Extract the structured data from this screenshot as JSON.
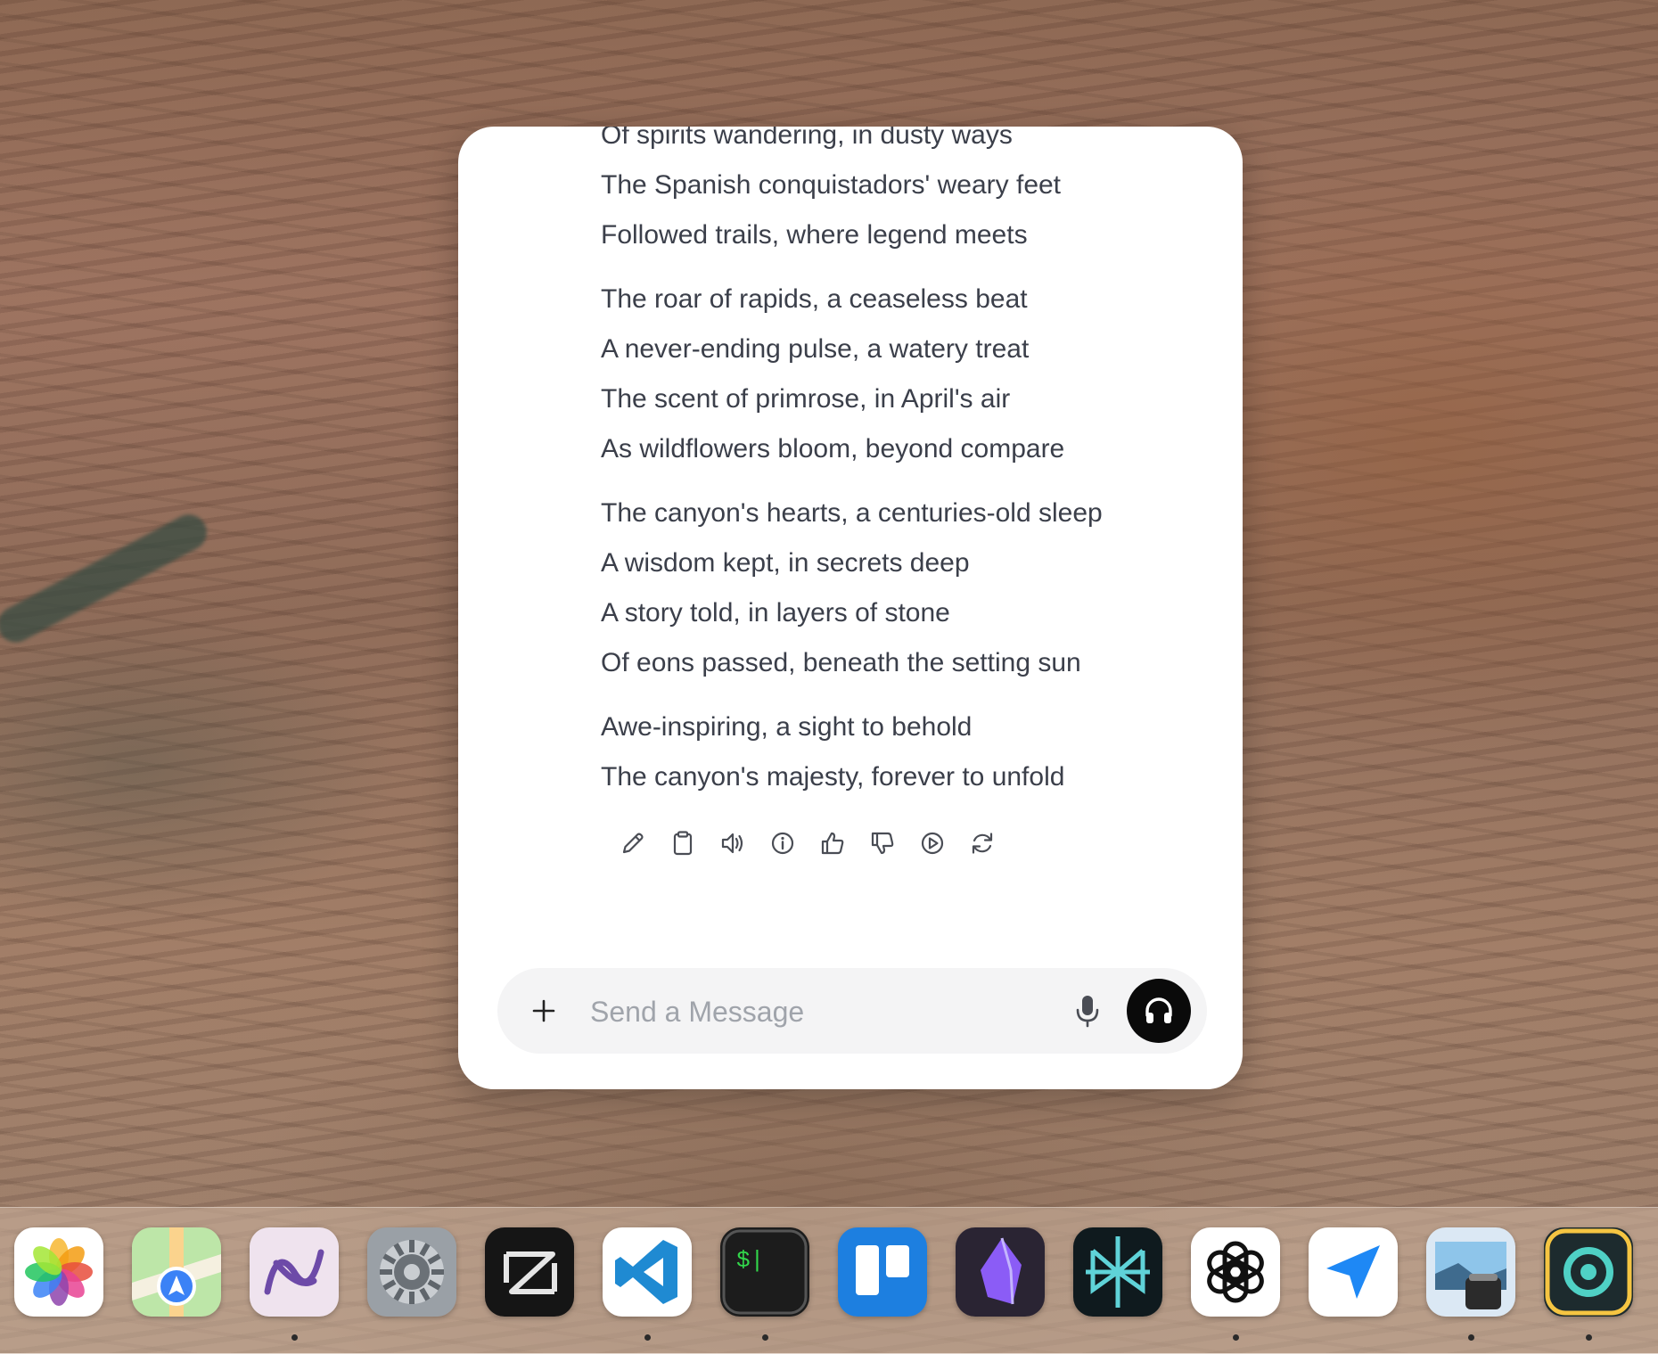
{
  "poem": {
    "stanzas": [
      {
        "lines": [
          "Of spirits wandering, in dusty ways",
          "The Spanish conquistadors' weary feet",
          "Followed trails, where legend meets"
        ]
      },
      {
        "lines": [
          "The roar of rapids, a ceaseless beat",
          "A never-ending pulse, a watery treat",
          "The scent of primrose, in April's air",
          "As wildflowers bloom, beyond compare"
        ]
      },
      {
        "lines": [
          "The canyon's hearts, a centuries-old sleep",
          "A wisdom kept, in secrets deep",
          "A story told, in layers of stone",
          "Of eons passed, beneath the setting sun"
        ]
      },
      {
        "lines": [
          "Awe-inspiring, a sight to behold",
          "The canyon's majesty, forever to unfold"
        ]
      }
    ]
  },
  "actions": [
    {
      "name": "edit-button",
      "icon": "pencil-icon"
    },
    {
      "name": "copy-button",
      "icon": "clipboard-icon"
    },
    {
      "name": "read-aloud-button",
      "icon": "speaker-icon"
    },
    {
      "name": "info-button",
      "icon": "info-icon"
    },
    {
      "name": "thumbs-up-button",
      "icon": "thumbs-up-icon"
    },
    {
      "name": "thumbs-down-button",
      "icon": "thumbs-down-icon"
    },
    {
      "name": "continue-button",
      "icon": "play-circle-icon"
    },
    {
      "name": "regenerate-button",
      "icon": "refresh-icon"
    }
  ],
  "composer": {
    "placeholder": "Send a Message",
    "value": ""
  },
  "dock": {
    "apps": [
      {
        "name": "photos",
        "icon": "photos-icon",
        "running": false
      },
      {
        "name": "maps",
        "icon": "maps-icon",
        "running": false
      },
      {
        "name": "arc-ai",
        "icon": "scribble-app-icon",
        "running": true
      },
      {
        "name": "system-settings",
        "icon": "gear-icon",
        "running": false
      },
      {
        "name": "zed",
        "icon": "zed-icon",
        "running": false
      },
      {
        "name": "vscode",
        "icon": "vscode-icon",
        "running": true
      },
      {
        "name": "terminal",
        "icon": "terminal-icon",
        "running": true
      },
      {
        "name": "trello",
        "icon": "trello-icon",
        "running": false
      },
      {
        "name": "obsidian",
        "icon": "obsidian-icon",
        "running": false
      },
      {
        "name": "perplexity",
        "icon": "perplexity-icon",
        "running": false
      },
      {
        "name": "chatgpt",
        "icon": "openai-icon",
        "running": true
      },
      {
        "name": "send",
        "icon": "paper-plane-icon",
        "running": false
      },
      {
        "name": "preview",
        "icon": "preview-icon",
        "running": true
      },
      {
        "name": "connect",
        "icon": "sync-app-icon",
        "running": true
      }
    ],
    "terminal_glyph": "$|"
  },
  "colors": {
    "text": "#3b3f4a",
    "icon": "#4a4d55",
    "composer_bg": "#f4f4f5",
    "voice_button": "#0a0a0a"
  }
}
